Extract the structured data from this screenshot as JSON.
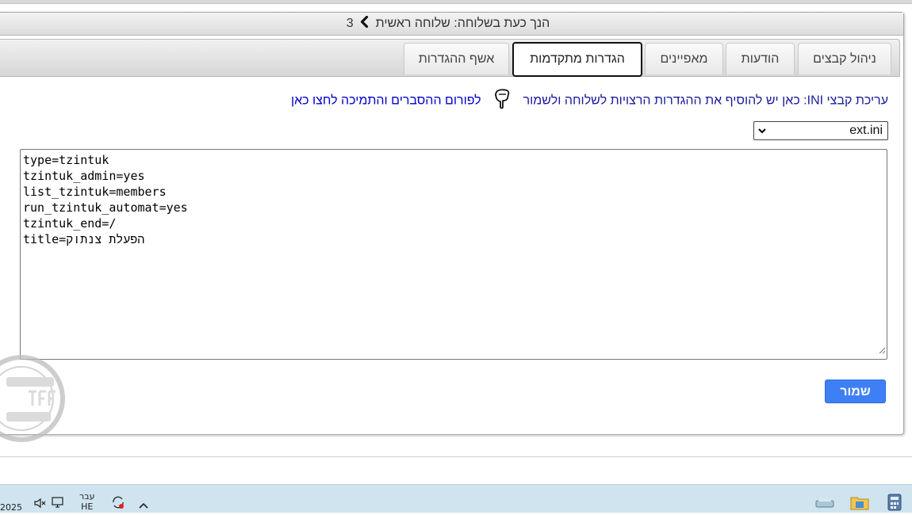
{
  "header": {
    "breadcrumb_text": "הנך כעת בשלוחה: שלוחה ראשית",
    "breadcrumb_number": "3"
  },
  "tabs": [
    {
      "label": "ניהול קבצים",
      "active": false
    },
    {
      "label": "הודעות",
      "active": false
    },
    {
      "label": "מאפיינים",
      "active": false
    },
    {
      "label": "הגדרות מתקדמות",
      "active": true
    },
    {
      "label": "אשף ההגדרות",
      "active": false
    }
  ],
  "info": {
    "text": "עריכת קבצי INI: כאן יש להוסיף את ההגדרות הרצויות לשלוחה ולשמור",
    "link": "לפורום ההסברים והתמיכה לחצו כאן"
  },
  "file_select": {
    "selected": "ext.ini"
  },
  "editor": {
    "lines": [
      "type=tzintuk",
      "tzintuk_admin=yes",
      "list_tzintuk=members",
      "run_tzintuk_automat=yes",
      "tzintuk_end=/",
      "title=הפעלת צנתוק"
    ]
  },
  "save_label": "שמור",
  "taskbar": {
    "clock_fragment": "2025",
    "lang_line1": "עבר",
    "lang_line2": "HE"
  },
  "colors": {
    "link": "#0000cc",
    "info_text": "#1b1b9c",
    "save_button": "#3f7ff5",
    "taskbar": "#cfe4ef"
  }
}
